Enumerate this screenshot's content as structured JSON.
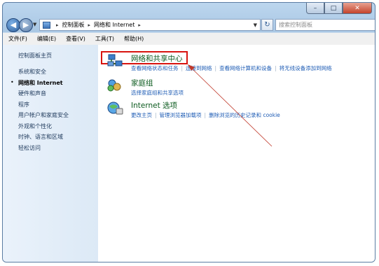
{
  "window": {
    "min_glyph": "–",
    "max_glyph": "□",
    "close_glyph": "✕"
  },
  "address": {
    "crumbs": [
      "控制面板",
      "网络和 Internet"
    ],
    "search_placeholder": "搜索控制面板"
  },
  "menu": [
    "文件(F)",
    "编辑(E)",
    "查看(V)",
    "工具(T)",
    "帮助(H)"
  ],
  "sidebar": {
    "items": [
      {
        "label": "控制面板主页"
      },
      {
        "label": "系统和安全"
      },
      {
        "label": "网络和 Internet",
        "active": true
      },
      {
        "label": "硬件和声音"
      },
      {
        "label": "程序"
      },
      {
        "label": "用户帐户和家庭安全"
      },
      {
        "label": "外观和个性化"
      },
      {
        "label": "时钟、语言和区域"
      },
      {
        "label": "轻松访问"
      }
    ]
  },
  "categories": [
    {
      "title": "网络和共享中心",
      "links": [
        "查看网络状态和任务",
        "连接到网络",
        "查看网络计算机和设备",
        "将无线设备添加到网络"
      ],
      "icon": "network-icon"
    },
    {
      "title": "家庭组",
      "links": [
        "选择家庭组和共享选项"
      ],
      "icon": "homegroup-icon"
    },
    {
      "title": "Internet 选项",
      "links": [
        "更改主页",
        "管理浏览器加载项",
        "删除浏览的历史记录和 cookie"
      ],
      "icon": "internet-options-icon"
    }
  ],
  "colors": {
    "highlight": "#d8140f",
    "link": "#1f5db5",
    "category_title": "#0b5a1e"
  }
}
